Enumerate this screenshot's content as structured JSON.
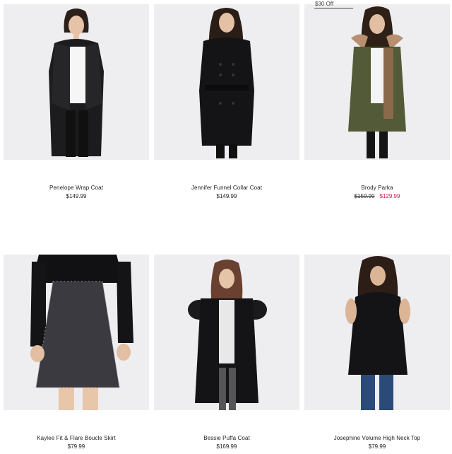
{
  "products": [
    {
      "name": "Penelope Wrap Coat",
      "price": "$149.99"
    },
    {
      "name": "Jennifer Funnel Collar Coat",
      "price": "$149.99"
    },
    {
      "name": "Brody Parka",
      "old_price": "$159.99",
      "sale_price": "$129.99",
      "badge": "$30 Off"
    },
    {
      "name": "Kaylee Fit & Flare Boucle Skirt",
      "price": "$79.99"
    },
    {
      "name": "Bessie Puffa Coat",
      "price": "$169.99"
    },
    {
      "name": "Josephine Volume High Neck Top",
      "price": "$79.99"
    }
  ],
  "colors": {
    "image_bg": "#eeeef0",
    "sale": "#d0204a"
  }
}
